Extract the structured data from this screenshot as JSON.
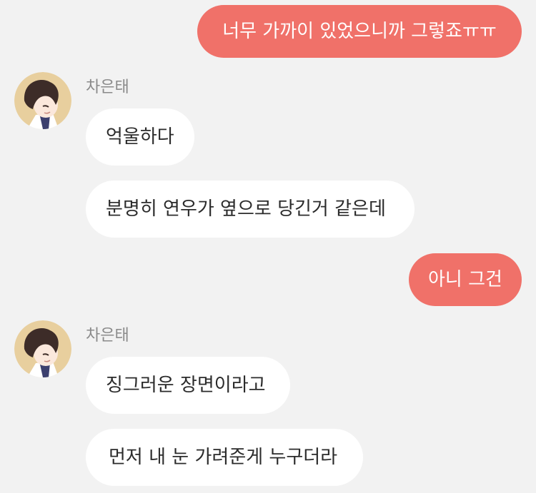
{
  "sender": {
    "name": "차은태",
    "avatar_icon": "character-portrait-icon"
  },
  "messages": [
    {
      "side": "outgoing",
      "text": "너무 가까이 있었으니까 그렇죠ㅠㅠ"
    },
    {
      "side": "incoming",
      "text": "억울하다"
    },
    {
      "side": "incoming",
      "text": "분명히 연우가 옆으로 당긴거 같은데"
    },
    {
      "side": "outgoing",
      "text": "아니 그건"
    },
    {
      "side": "incoming",
      "text": "징그러운 장면이라고"
    },
    {
      "side": "incoming",
      "text": "먼저 내 눈 가려준게 누구더라"
    }
  ],
  "colors": {
    "background": "#f2f2f2",
    "outgoing_bubble": "#f07169",
    "incoming_bubble": "#ffffff",
    "sender_name": "#8a8a8a"
  }
}
